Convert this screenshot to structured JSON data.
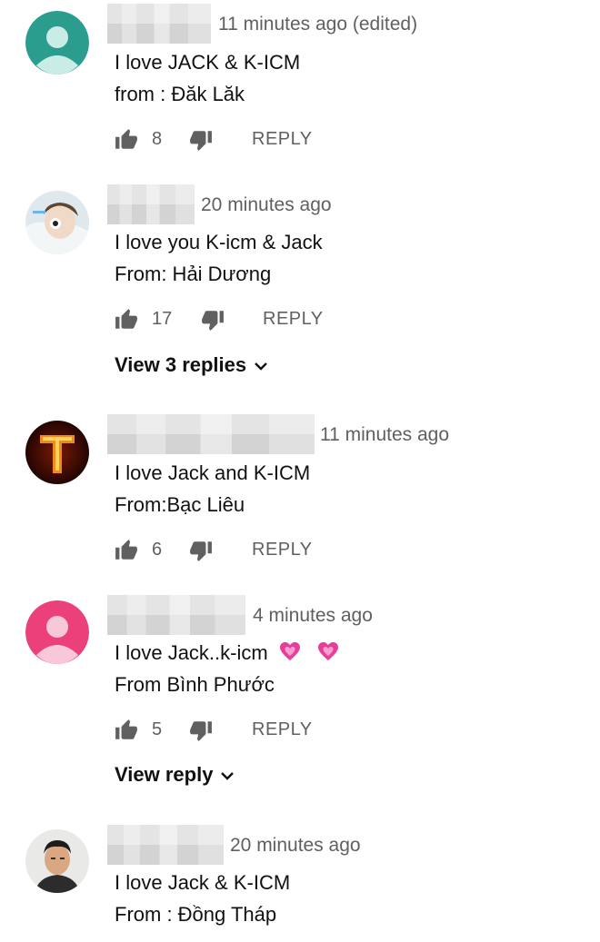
{
  "icons": {
    "like": "thumb-up-icon",
    "dislike": "thumb-down-icon",
    "expand": "chevron-down-icon",
    "heart": "heart-emoji-icon"
  },
  "colors": {
    "text": "#111111",
    "meta": "#606060",
    "avatar_teal": "#2a9d8f",
    "avatar_pink": "#ec407a"
  },
  "reply_label": "REPLY",
  "comments": [
    {
      "time": "11 minutes ago (edited)",
      "lines": [
        "I love JACK & K-ICM",
        "from : Đăk Lăk"
      ],
      "likes": "8",
      "view_replies": ""
    },
    {
      "time": "20 minutes ago",
      "lines": [
        "I love you K-icm & Jack",
        "From: Hải Dương"
      ],
      "likes": "17",
      "view_replies": "View 3 replies"
    },
    {
      "time": "11 minutes ago",
      "lines": [
        "I love Jack and K-ICM",
        "From:Bạc Liêu"
      ],
      "likes": "6",
      "view_replies": ""
    },
    {
      "time": "4 minutes ago",
      "lines": [
        "I love Jack..k-icm",
        "From Bình Phước"
      ],
      "likes": "5",
      "view_replies": "View reply"
    },
    {
      "time": "20 minutes ago",
      "lines": [
        "I love Jack & K-ICM",
        "From : Đồng Tháp"
      ],
      "likes": "",
      "view_replies": ""
    }
  ]
}
